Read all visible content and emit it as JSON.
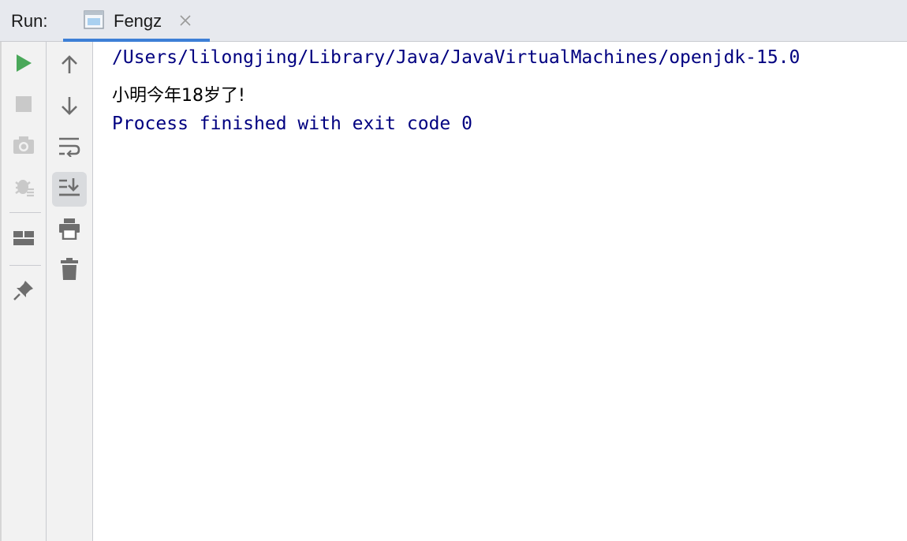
{
  "tabbar": {
    "run_label": "Run:",
    "tab_title": "Fengz"
  },
  "left_toolbar": [
    "run-icon",
    "stop-icon",
    "camera-icon",
    "debug-icon",
    "layout-icon",
    "pin-icon"
  ],
  "right_toolbar": [
    "arrow-up-icon",
    "arrow-down-icon",
    "soft-wrap-icon",
    "scroll-to-end-icon",
    "print-icon",
    "trash-icon"
  ],
  "console": {
    "lines": [
      "/Users/lilongjing/Library/Java/JavaVirtualMachines/openjdk-15.0",
      "小明今年18岁了!",
      "Process finished with exit code 0"
    ]
  },
  "colors": {
    "accent": "#3d7fd6",
    "run_green": "#4aa85a",
    "console_blue": "#000080"
  }
}
